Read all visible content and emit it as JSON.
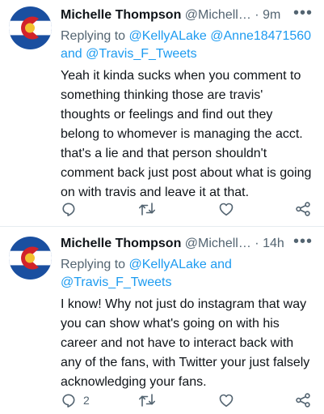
{
  "colors": {
    "text": "#0f1419",
    "muted": "#536471",
    "link": "#1d9bf0",
    "divider": "#e6ecf0"
  },
  "tweets": [
    {
      "name": "Michelle Thompson",
      "handle": "@Michell…",
      "separator": "·",
      "time": "9m",
      "more": "•••",
      "replying_prefix": "Replying to ",
      "mention_1": "@KellyALake",
      "mention_2": "@Anne18471560",
      "connector": "and",
      "mention_3": "@Travis_F_Tweets",
      "text": "Yeah it kinda sucks when you comment to something thinking those are travis' thoughts or feelings and find out they belong to whomever is managing the acct. that's a lie and that person shouldn't comment back just post about what is going on with travis and leave it at that.",
      "reply_count": ""
    },
    {
      "name": "Michelle Thompson",
      "handle": "@Michell…",
      "separator": "·",
      "time": "14h",
      "more": "•••",
      "replying_prefix": "Replying to ",
      "mention_1": "@KellyALake",
      "connector": "and",
      "mention_2": "@Travis_F_Tweets",
      "text": "I know! Why not just do instagram that way you can show what's going on with his career and not have to interact back with any of the fans, with Twitter your just falsely acknowledging your fans.",
      "reply_count": "2"
    }
  ],
  "icons": [
    "reply-icon",
    "retweet-icon",
    "like-icon",
    "share-icon",
    "more-icon"
  ]
}
